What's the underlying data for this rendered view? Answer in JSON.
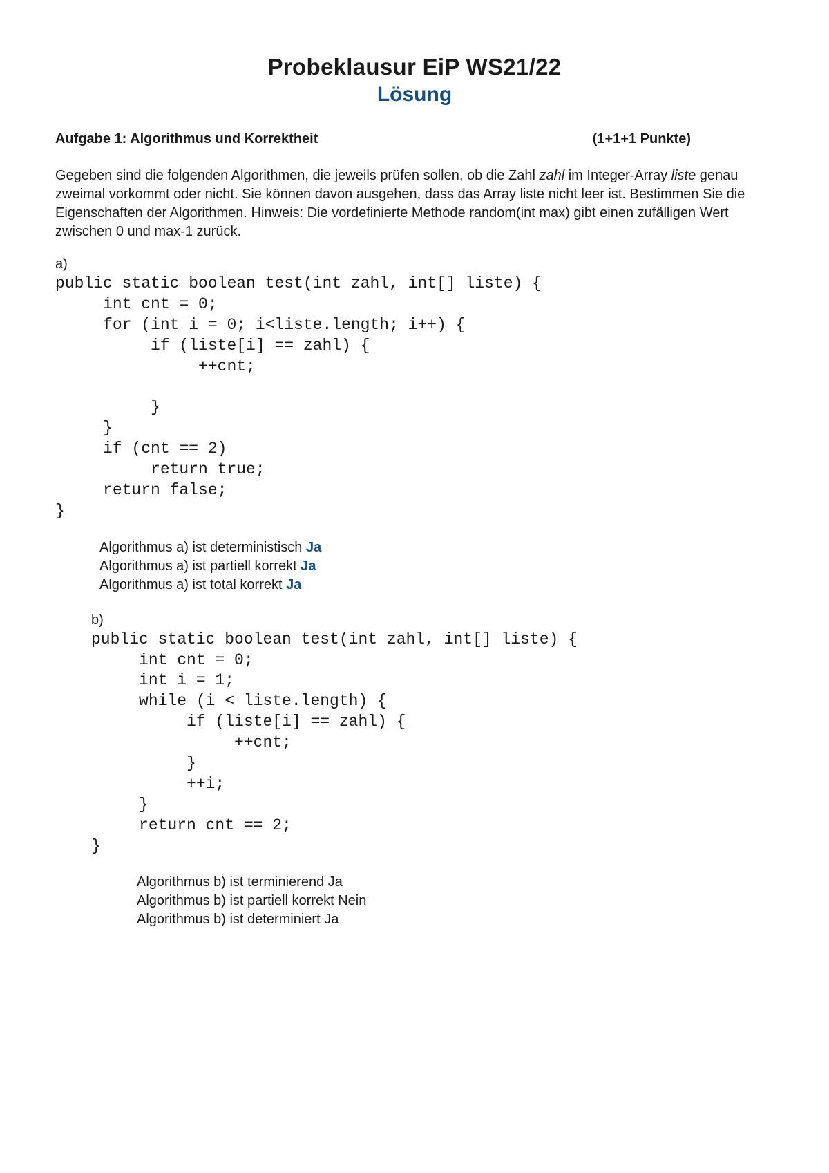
{
  "title": {
    "main": "Probeklausur EiP WS21/22",
    "sub": "Lösung"
  },
  "task": {
    "heading": "Aufgabe 1: Algorithmus und Korrektheit",
    "points": "(1+1+1 Punkte)"
  },
  "intro": {
    "text1": "Gegeben sind die folgenden Algorithmen, die jeweils prüfen sollen, ob die Zahl ",
    "zahl": "zahl",
    "text2": " im Integer-Array ",
    "liste": "liste",
    "text3": " genau zweimal vorkommt oder nicht. Sie können davon ausgehen, dass das Array liste nicht leer ist. Bestimmen Sie die Eigenschaften der Algorithmen. Hinweis: Die vordefinierte Methode random(int max) gibt einen zufälligen Wert zwischen 0 und max-1 zurück."
  },
  "partA": {
    "label": "a)",
    "code": "public static boolean test(int zahl, int[] liste) {\n     int cnt = 0;\n     for (int i = 0; i<liste.length; i++) {\n          if (liste[i] == zahl) {\n               ++cnt;\n\n          }\n     }\n     if (cnt == 2)\n          return true;\n     return false;\n}",
    "answers": {
      "line1_text": "Algorithmus a) ist deterministisch ",
      "line1_ans": "Ja",
      "line2_text": "Algorithmus a) ist partiell korrekt ",
      "line2_ans": "Ja",
      "line3_text": "Algorithmus a) ist total korrekt ",
      "line3_ans": "Ja"
    }
  },
  "partB": {
    "label": "b)",
    "code": "public static boolean test(int zahl, int[] liste) {\n     int cnt = 0;\n     int i = 1;\n     while (i < liste.length) {\n          if (liste[i] == zahl) {\n               ++cnt;\n          }\n          ++i;\n     }\n     return cnt == 2;\n}",
    "answers": {
      "line1_text": "Algorithmus b) ist terminierend ",
      "line1_ans": "Ja",
      "line2_text": "Algorithmus b) ist partiell korrekt ",
      "line2_ans": "Nein",
      "line3_text": "Algorithmus b) ist determiniert ",
      "line3_ans": "Ja"
    }
  }
}
